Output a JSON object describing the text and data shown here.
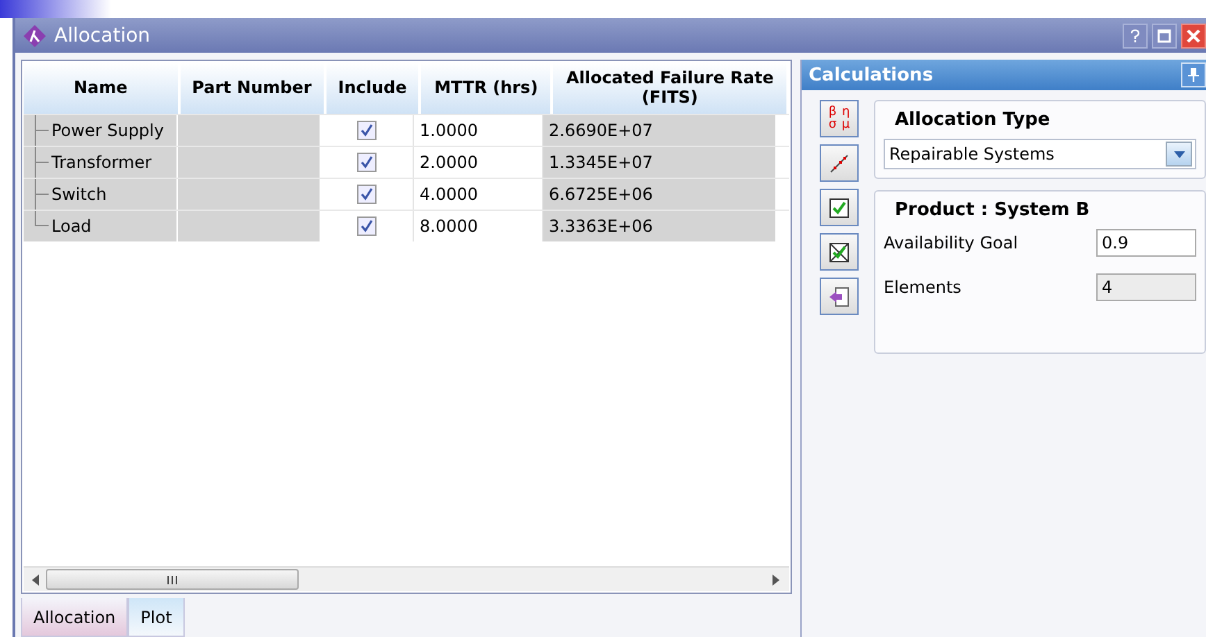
{
  "window": {
    "title": "Allocation"
  },
  "grid": {
    "columns": [
      "Name",
      "Part Number",
      "Include",
      "MTTR (hrs)",
      "Allocated Failure Rate (FITS)"
    ],
    "rows": [
      {
        "name": "Power Supply",
        "part_number": "",
        "include": true,
        "mttr": "1.0000",
        "rate": "2.6690E+07"
      },
      {
        "name": "Transformer",
        "part_number": "",
        "include": true,
        "mttr": "2.0000",
        "rate": "1.3345E+07"
      },
      {
        "name": "Switch",
        "part_number": "",
        "include": true,
        "mttr": "4.0000",
        "rate": "6.6725E+06"
      },
      {
        "name": "Load",
        "part_number": "",
        "include": true,
        "mttr": "8.0000",
        "rate": "3.3363E+06"
      }
    ]
  },
  "tabs": [
    {
      "label": "Allocation",
      "selected": true
    },
    {
      "label": "Plot",
      "selected": false
    }
  ],
  "calculations": {
    "title": "Calculations",
    "tools": [
      {
        "kind": "greek",
        "label": "β η σ μ"
      },
      {
        "kind": "plot"
      },
      {
        "kind": "check"
      },
      {
        "kind": "uncheck"
      },
      {
        "kind": "back"
      }
    ],
    "allocation_type": {
      "title": "Allocation Type",
      "value": "Repairable Systems"
    },
    "product": {
      "title": "Product : System B",
      "fields": [
        {
          "label": "Availability Goal",
          "value": "0.9",
          "disabled": false
        },
        {
          "label": "Elements",
          "value": "4",
          "disabled": true
        }
      ]
    }
  }
}
